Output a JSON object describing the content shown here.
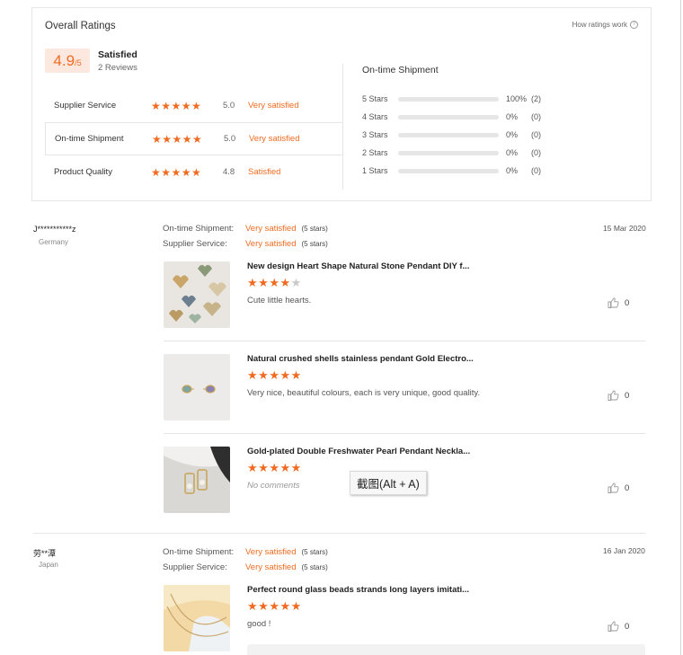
{
  "overall": {
    "title": "Overall Ratings",
    "how_link": "How ratings work",
    "score": "4.9",
    "score_suffix": "/5",
    "satisfaction": "Satisfied",
    "reviews": "2 Reviews",
    "criteria": [
      {
        "name": "Supplier Service",
        "score": "5.0",
        "desc": "Very satisfied",
        "stars": 5
      },
      {
        "name": "On-time Shipment",
        "score": "5.0",
        "desc": "Very satisfied",
        "stars": 5
      },
      {
        "name": "Product Quality",
        "score": "4.8",
        "desc": "Satisfied",
        "stars": 5
      }
    ],
    "shipment": {
      "title": "On-time Shipment",
      "rows": [
        {
          "label": "5 Stars",
          "pct": "100%",
          "count": "(2)",
          "fill": 1.0
        },
        {
          "label": "4 Stars",
          "pct": "0%",
          "count": "(0)",
          "fill": 0
        },
        {
          "label": "3 Stars",
          "pct": "0%",
          "count": "(0)",
          "fill": 0
        },
        {
          "label": "2 Stars",
          "pct": "0%",
          "count": "(0)",
          "fill": 0
        },
        {
          "label": "1 Stars",
          "pct": "0%",
          "count": "(0)",
          "fill": 0
        }
      ]
    }
  },
  "reviews": [
    {
      "reviewer": "J***********z",
      "country": "Germany",
      "date": "15 Mar 2020",
      "meta": [
        {
          "key": "On-time Shipment:",
          "value": "Very satisfied",
          "stars": "(5 stars)"
        },
        {
          "key": "Supplier Service:",
          "value": "Very satisfied",
          "stars": "(5 stars)"
        }
      ],
      "items": [
        {
          "title": "New design Heart Shape Natural Stone Pendant DIY f...",
          "rating": 4,
          "text": "Cute little hearts.",
          "likes": "0"
        },
        {
          "title": "Natural crushed shells stainless pendant Gold Electro...",
          "rating": 5,
          "text": "Very nice, beautiful colours, each is very unique, good quality.",
          "likes": "0"
        },
        {
          "title": "Gold-plated Double Freshwater Pearl Pendant Neckla...",
          "rating": 5,
          "text": "No comments",
          "likes": "0"
        }
      ]
    },
    {
      "reviewer": "劳**潭",
      "country": "Japan",
      "date": "16 Jan 2020",
      "meta": [
        {
          "key": "On-time Shipment:",
          "value": "Very satisfied",
          "stars": "(5 stars)"
        },
        {
          "key": "Supplier Service:",
          "value": "Very satisfied",
          "stars": "(5 stars)"
        }
      ],
      "items": [
        {
          "title": "Perfect round glass beads strands long layers imitati...",
          "rating": 5,
          "text": "good !",
          "likes": "0"
        }
      ]
    }
  ],
  "tooltip": "截图(Alt + A)",
  "colors": {
    "accent": "#f06b21",
    "score_bg": "#fde8e0",
    "star_off": "#c9c9c9"
  }
}
